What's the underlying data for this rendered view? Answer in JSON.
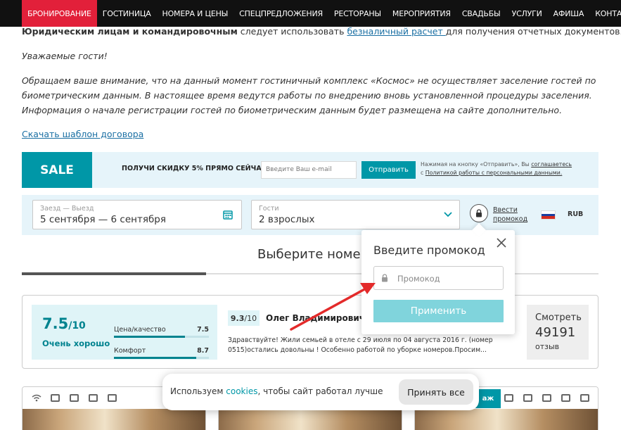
{
  "nav": {
    "items": [
      "БРОНИРОВАНИЕ",
      "ГОСТИНИЦА",
      "НОМЕРА И ЦЕНЫ",
      "СПЕЦПРЕДЛОЖЕНИЯ",
      "РЕСТОРАНЫ",
      "МЕРОПРИЯТИЯ",
      "СВАДЬБЫ",
      "УСЛУГИ",
      "АФИША",
      "КОНТАКТЫ"
    ],
    "active_index": 0
  },
  "article": {
    "p1_bold": "Юридическим лицам и командировочным",
    "p1_text": " следует использовать ",
    "p1_link": "безналичный расчет ",
    "p1_tail": "для получения отчетных документов.",
    "greeting": "Уважаемые гости!",
    "notice": "Обращаем ваше внимание, что на данный момент гостиничный комплекс «Космос» не осуществляет заселение гостей по биометрическим данным.  В настоящее время ведутся работы по внедрению вновь установленной процедуры заселения. Информация о начале регистрации гостей по биометрическим данным будет размещена на сайте дополнительно.",
    "template_link": "Скачать шаблон договора"
  },
  "sale": {
    "tag": "SALE",
    "promo": "ПОЛУЧИ СКИДКУ 5% ПРЯМО СЕЙЧАС!",
    "email_placeholder": "Введите Ваш e-mail",
    "send_label": "Отправить",
    "legal_pre": "Нажимая на кнопку «Отправить», Вы ",
    "legal_link1": "соглашаетесь",
    "legal_mid": "с ",
    "legal_link2": "Политикой работы с персональными данными."
  },
  "booking": {
    "dates_label": "Заезд — Выезд",
    "dates_value": "5 сентября — 6 сентября",
    "guests_label": "Гости",
    "guests_value": "2 взрослых",
    "promo_link_l1": "Ввести",
    "promo_link_l2": "промокод",
    "currency": "RUB"
  },
  "main": {
    "choose_title": "Выберите номер"
  },
  "reviews": {
    "score": "7.5",
    "score_max": "/10",
    "score_word": "Очень хорошо",
    "criteria": [
      {
        "name": "Цена/качество",
        "value": "7.5",
        "fraction": 0.75
      },
      {
        "name": "Комфорт",
        "value": "8.7",
        "fraction": 0.87
      }
    ],
    "review_score": "9.3",
    "review_score_max": "/10",
    "review_author": "Олег Владимирович",
    "review_text": "Здравствуйте! Жили семьей в отеле с 29 июля по 04 августа 2016 г. (номер 0515)остались довольны ! Особенно работой по уборке номеров.Просим...",
    "view_l1": "Смотреть",
    "view_l2": "49191",
    "view_l3": "отзыв"
  },
  "room_cards": {
    "badge": "аж"
  },
  "cookie": {
    "text_pre": "Используем ",
    "link": "cookies",
    "text_post": ", чтобы сайт работал лучше",
    "accept": "Принять все"
  },
  "promo_popup": {
    "title": "Введите промокод",
    "placeholder": "Промокод",
    "apply": "Применить"
  },
  "colors": {
    "accent": "#0097a7",
    "nav_active": "#e2203a",
    "arrow": "#e32a2a"
  }
}
